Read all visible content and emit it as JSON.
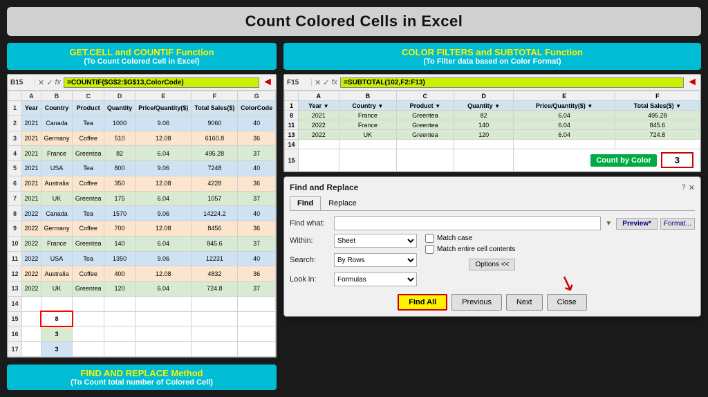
{
  "title": "Count Colored Cells in Excel",
  "left_section": {
    "title": "GET.CELL and COUNTIF Function",
    "subtitle": "(To Count Colored Cell in Excel)"
  },
  "right_section": {
    "title": "COLOR FILTERS and SUBTOTAL Function",
    "subtitle": "(To Filter data based on Color Format)"
  },
  "bottom_left_section": {
    "title": "FIND AND REPLACE Method",
    "subtitle": "(To Count total number of Colored Cell)"
  },
  "left_formula_bar": {
    "cell_ref": "B15",
    "formula": "=COUNTIF($G$2:$G$13,ColorCode)"
  },
  "right_formula_bar": {
    "cell_ref": "F15",
    "formula": "=SUBTOTAL(102,F2:F13)"
  },
  "left_spreadsheet": {
    "col_headers": [
      "A",
      "B",
      "C",
      "D",
      "E",
      "F",
      "G"
    ],
    "col_labels": [
      "Year",
      "Country",
      "Product",
      "Quantity",
      "Price/Quantity($)",
      "Total Sales($)",
      "ColorCode"
    ],
    "rows": [
      {
        "row": 2,
        "data": [
          "2021",
          "Canada",
          "Tea",
          "1000",
          "9.06",
          "9060",
          "40"
        ],
        "bg": "blue"
      },
      {
        "row": 3,
        "data": [
          "2021",
          "Germany",
          "Coffee",
          "510",
          "12.08",
          "6160.8",
          "36"
        ],
        "bg": "orange"
      },
      {
        "row": 4,
        "data": [
          "2021",
          "France",
          "Greentea",
          "82",
          "6.04",
          "495.28",
          "37"
        ],
        "bg": "green"
      },
      {
        "row": 5,
        "data": [
          "2021",
          "USA",
          "Tea",
          "800",
          "9.06",
          "7248",
          "40"
        ],
        "bg": "blue"
      },
      {
        "row": 6,
        "data": [
          "2021",
          "Australia",
          "Coffee",
          "350",
          "12.08",
          "4228",
          "36"
        ],
        "bg": "orange"
      },
      {
        "row": 7,
        "data": [
          "2021",
          "UK",
          "Greentea",
          "175",
          "6.04",
          "1057",
          "37"
        ],
        "bg": "green"
      },
      {
        "row": 8,
        "data": [
          "2022",
          "Canada",
          "Tea",
          "1570",
          "9.06",
          "14224.2",
          "40"
        ],
        "bg": "blue"
      },
      {
        "row": 9,
        "data": [
          "2022",
          "Germany",
          "Coffee",
          "700",
          "12.08",
          "8456",
          "36"
        ],
        "bg": "orange"
      },
      {
        "row": 10,
        "data": [
          "2022",
          "France",
          "Greentea",
          "140",
          "6.04",
          "845.6",
          "37"
        ],
        "bg": "green"
      },
      {
        "row": 11,
        "data": [
          "2022",
          "USA",
          "Tea",
          "1350",
          "9.06",
          "12231",
          "40"
        ],
        "bg": "blue"
      },
      {
        "row": 12,
        "data": [
          "2022",
          "Australia",
          "Coffee",
          "400",
          "12.08",
          "4832",
          "36"
        ],
        "bg": "orange"
      },
      {
        "row": 13,
        "data": [
          "2022",
          "UK",
          "Greentea",
          "120",
          "6.04",
          "724.8",
          "37"
        ],
        "bg": "green"
      }
    ],
    "extra_rows": [
      {
        "row": 15,
        "data": [
          "",
          "8",
          "",
          "",
          "",
          "",
          ""
        ],
        "special": "selected"
      },
      {
        "row": 16,
        "data": [
          "",
          "3",
          "",
          "",
          "",
          "",
          ""
        ]
      },
      {
        "row": 17,
        "data": [
          "",
          "3",
          "",
          "",
          "",
          "",
          ""
        ]
      }
    ]
  },
  "right_spreadsheet": {
    "col_headers": [
      "A",
      "B",
      "C",
      "D",
      "E",
      "F"
    ],
    "col_labels": [
      "Year",
      "Country",
      "Product",
      "Quantity",
      "Price/Quantity($)",
      "Total Sales($)"
    ],
    "rows": [
      {
        "row": 1,
        "data": [
          "Year",
          "Country",
          "Product",
          "Quantity",
          "Price/Quantity($)",
          "Total Sales($)"
        ],
        "is_header": true
      },
      {
        "row": 8,
        "data": [
          "2021",
          "France",
          "Greentea",
          "82",
          "6.04",
          "495.28"
        ],
        "bg": "green"
      },
      {
        "row": 11,
        "data": [
          "2022",
          "France",
          "Greentea",
          "140",
          "6.04",
          "845.6"
        ],
        "bg": "green"
      },
      {
        "row": 13,
        "data": [
          "2022",
          "UK",
          "Greentea",
          "120",
          "6.04",
          "724.8"
        ],
        "bg": "green"
      }
    ]
  },
  "count_by_color": {
    "label": "Count by Color",
    "value": "3"
  },
  "find_replace_dialog": {
    "title": "Find and Replace",
    "tab_find": "Find",
    "tab_replace": "Replace",
    "find_what_label": "Find what:",
    "within_label": "Within:",
    "within_value": "Sheet",
    "search_label": "Search:",
    "search_value": "By Rows",
    "look_in_label": "Look in:",
    "look_in_value": "Formulas",
    "match_case": "Match case",
    "match_entire": "Match entire cell contents",
    "btn_preview": "Preview*",
    "btn_format": "Format...",
    "btn_options": "Options <<",
    "btn_find_all": "Find All",
    "btn_previous": "Previous",
    "btn_next": "Next",
    "btn_close": "Close"
  }
}
